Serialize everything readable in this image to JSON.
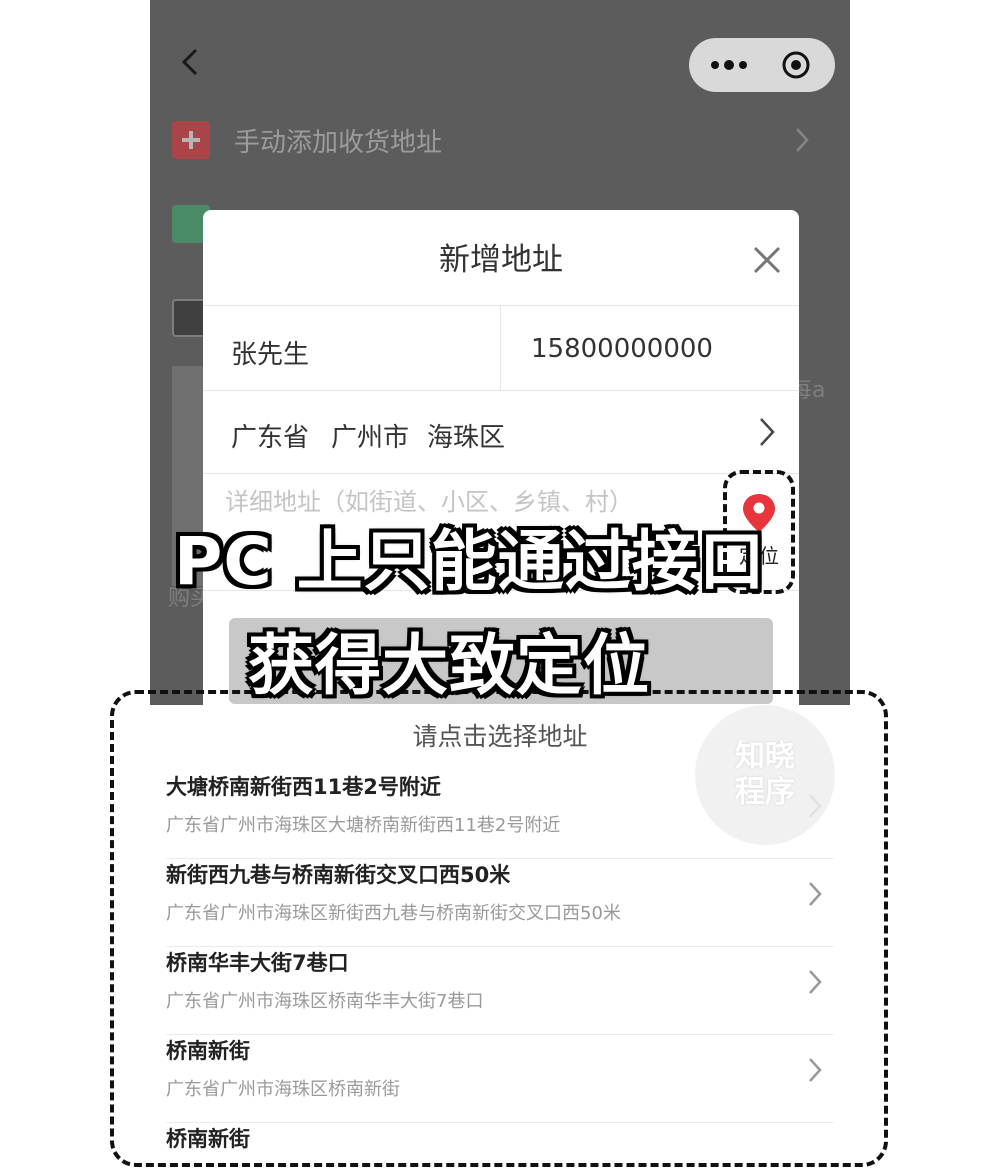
{
  "background_list": {
    "manual_add_label": "手动添加收货地址",
    "partial_text_right": "每a",
    "partial_text_left": "购买"
  },
  "modal": {
    "title": "新增地址",
    "name_value": "张先生",
    "phone_value": "15800000000",
    "region": {
      "province": "广东省",
      "city": "广州市",
      "district": "海珠区"
    },
    "detail_placeholder": "详细地址（如街道、小区、乡镇、村）",
    "locate_label": "定位"
  },
  "caption": {
    "line1": "PC 上只能通过接口",
    "line2": "获得大致定位"
  },
  "picker": {
    "title": "请点击选择地址",
    "items": [
      {
        "name": "大塘桥南新街西11巷2号附近",
        "address": "广东省广州市海珠区大塘桥南新街西11巷2号附近"
      },
      {
        "name": "新街西九巷与桥南新街交叉口西50米",
        "address": "广东省广州市海珠区新街西九巷与桥南新街交叉口西50米"
      },
      {
        "name": "桥南华丰大街7巷口",
        "address": "广东省广州市海珠区桥南华丰大街7巷口"
      },
      {
        "name": "桥南新街",
        "address": "广东省广州市海珠区桥南新街"
      },
      {
        "name": "桥南新街",
        "address": ""
      }
    ]
  },
  "watermark": {
    "line1": "知晓",
    "line2": "程序"
  },
  "colors": {
    "accent_red": "#e8343b",
    "dim_bg": "#5c5c5c",
    "disabled_button": "#c8c8c8"
  },
  "icons": [
    "back-icon",
    "more-dots-icon",
    "target-icon",
    "plus-icon",
    "wechat-icon",
    "close-icon",
    "chevron-right-icon",
    "location-pin-icon"
  ]
}
